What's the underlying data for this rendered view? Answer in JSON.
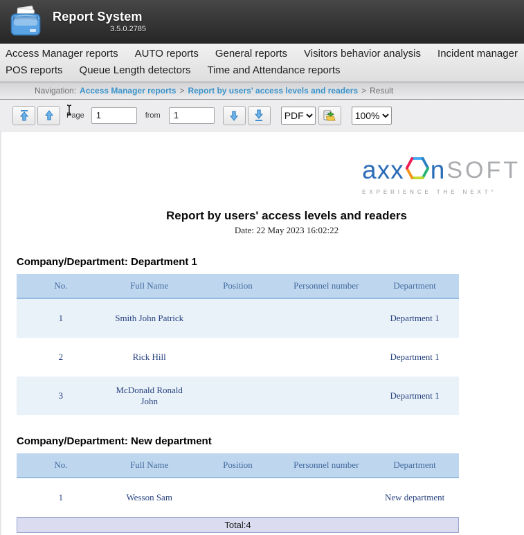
{
  "app": {
    "title": "Report System",
    "version": "3.5.0.2785"
  },
  "menu": {
    "row1": [
      "Access Manager reports",
      "AUTO reports",
      "General reports",
      "Visitors behavior analysis",
      "Incident manager"
    ],
    "row2": [
      "POS reports",
      "Queue Length detectors",
      "Time and Attendance reports"
    ]
  },
  "breadcrumb": {
    "label": "Navigation:",
    "separator": ">",
    "items": [
      {
        "text": "Access Manager reports",
        "link": true
      },
      {
        "text": "Report by users' access levels and readers",
        "link": true
      },
      {
        "text": "Result",
        "link": false
      }
    ]
  },
  "toolbar": {
    "first_page_icon": "arrow-up-with-bar",
    "prev_page_icon": "arrow-up",
    "next_page_icon": "arrow-down",
    "last_page_icon": "arrow-down-with-bar",
    "page_label": "Page",
    "from_label": "from",
    "page_value": "1",
    "total_pages_value": "1",
    "format_value": "PDF",
    "export_icon": "export-document",
    "zoom_value": "100%"
  },
  "report": {
    "logo": {
      "part1": "axx",
      "part2": "n",
      "part3": "SOFT",
      "tagline": "EXPERIENCE THE NEXT°"
    },
    "title": "Report by users' access levels and readers",
    "date": "Date: 22 May 2023 16:02:22",
    "columns": [
      "No.",
      "Full Name",
      "Position",
      "Personnel number",
      "Department"
    ],
    "sections": [
      {
        "heading": "Company/Department: Department 1",
        "rows": [
          {
            "no": "1",
            "full_name": "Smith John Patrick",
            "position": "",
            "personnel_number": "",
            "department": "Department 1"
          },
          {
            "no": "2",
            "full_name": "Rick Hill",
            "position": "",
            "personnel_number": "",
            "department": "Department 1"
          },
          {
            "no": "3",
            "full_name": "McDonald Ronald\nJohn",
            "position": "",
            "personnel_number": "",
            "department": "Department 1"
          }
        ]
      },
      {
        "heading": "Company/Department: New department",
        "rows": [
          {
            "no": "1",
            "full_name": "Wesson Sam",
            "position": "",
            "personnel_number": "",
            "department": "New department"
          }
        ]
      }
    ],
    "total": "Total:4"
  },
  "colors": {
    "header_accent": "#2c6db8",
    "table_header_bg": "#bed7ef",
    "row_shaded_bg": "#e9f1f9",
    "cell_text": "#27427e",
    "total_bg": "#dcdcf1",
    "link": "#3a94cc"
  }
}
